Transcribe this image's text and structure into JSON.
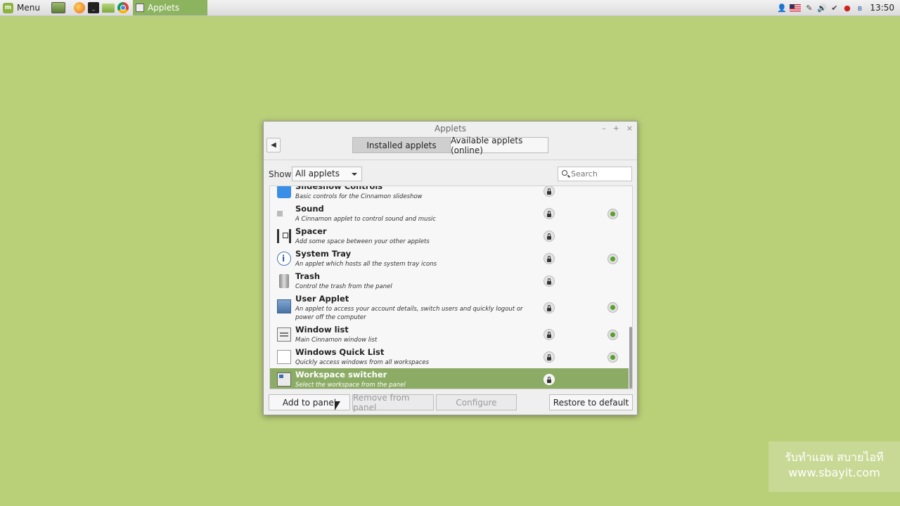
{
  "panel": {
    "menu_label": "Menu",
    "task_title": "Applets",
    "clock": "13:50"
  },
  "window": {
    "title": "Applets",
    "controls": [
      "–",
      "+",
      "×"
    ],
    "tabs": [
      {
        "label": "Installed applets",
        "active": true
      },
      {
        "label": "Available applets (online)",
        "active": false
      }
    ],
    "show_label": "Show",
    "show_value": "All applets",
    "search_placeholder": "Search"
  },
  "applets": [
    {
      "name": "Slideshow Controls",
      "description": "Basic controls for the Cinnamon slideshow",
      "icon": "slideshow-icon",
      "active": false
    },
    {
      "name": "Sound",
      "description": "A Cinnamon applet to control sound and music",
      "icon": "sound-icon",
      "active": true
    },
    {
      "name": "Spacer",
      "description": "Add some space between your other applets",
      "icon": "spacer-icon",
      "active": false
    },
    {
      "name": "System Tray",
      "description": "An applet which hosts all the system tray icons",
      "icon": "system-tray-icon",
      "active": true
    },
    {
      "name": "Trash",
      "description": "Control the trash from the panel",
      "icon": "trash-icon",
      "active": false
    },
    {
      "name": "User Applet",
      "description": "An applet to access your account details, switch users and quickly logout or power off the computer",
      "icon": "user-icon",
      "active": true
    },
    {
      "name": "Window list",
      "description": "Main Cinnamon window list",
      "icon": "window-list-icon",
      "active": true
    },
    {
      "name": "Windows Quick List",
      "description": "Quickly access windows from all workspaces",
      "icon": "windows-quick-list-icon",
      "active": true
    },
    {
      "name": "Workspace switcher",
      "description": "Select the workspace from the panel",
      "icon": "workspace-switcher-icon",
      "active": false,
      "selected": true
    }
  ],
  "buttons": {
    "add": "Add to panel",
    "remove": "Remove from panel",
    "configure": "Configure",
    "restore": "Restore to default"
  },
  "watermark": {
    "line1": "รับทำแอพ สบายไอที",
    "line2": "www.sbayit.com"
  },
  "colors": {
    "desktop": "#b9cf78",
    "selection": "#8cac66",
    "active_dot": "#5aa02c"
  }
}
